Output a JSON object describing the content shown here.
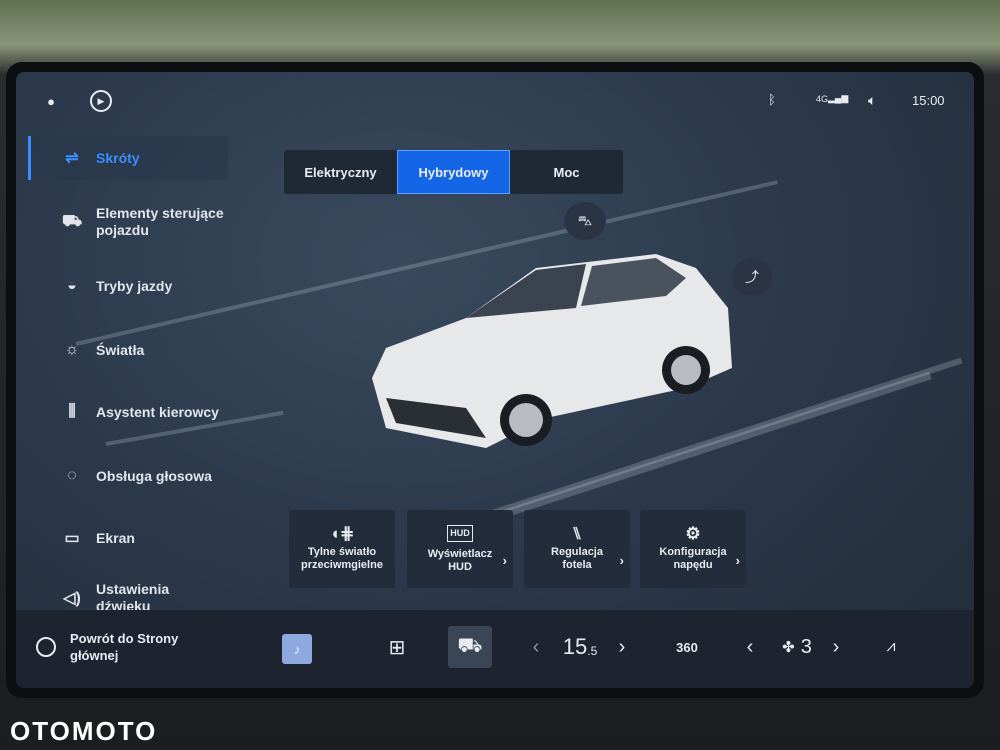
{
  "status": {
    "time": "15:00",
    "network": "4G"
  },
  "sidebar": {
    "items": [
      {
        "label": "Skróty",
        "icon": "shortcuts-icon",
        "active": true
      },
      {
        "label": "Elementy sterujące pojazdu",
        "icon": "car-icon"
      },
      {
        "label": "Tryby jazdy",
        "icon": "steering-wheel-icon"
      },
      {
        "label": "Światła",
        "icon": "light-icon"
      },
      {
        "label": "Asystent kierowcy",
        "icon": "driver-assist-icon"
      },
      {
        "label": "Obsługa głosowa",
        "icon": "voice-icon"
      },
      {
        "label": "Ekran",
        "icon": "screen-icon"
      },
      {
        "label": "Ustawienia dźwięku",
        "icon": "sound-icon"
      },
      {
        "label": "Powrót do Strony głównej",
        "icon": "home-icon"
      }
    ]
  },
  "modes": {
    "options": [
      "Elektryczny",
      "Hybrydowy",
      "Moc"
    ],
    "selected": "Hybrydowy"
  },
  "tiles": [
    {
      "label": "Tylne światło przeciwmgielne",
      "icon": "rear-fog-light-icon"
    },
    {
      "label": "Wyświetlacz HUD",
      "icon": "hud-icon",
      "badge": "HUD"
    },
    {
      "label": "Regulacja fotela",
      "icon": "seat-icon"
    },
    {
      "label": "Konfiguracja napędu",
      "icon": "drive-config-icon"
    }
  ],
  "bottom": {
    "temperature": "15",
    "temperature_decimal": ".5",
    "fan_speed": "3",
    "camera_label": "360"
  },
  "watermark": "OTOMOTO",
  "accent": "#1466e6"
}
